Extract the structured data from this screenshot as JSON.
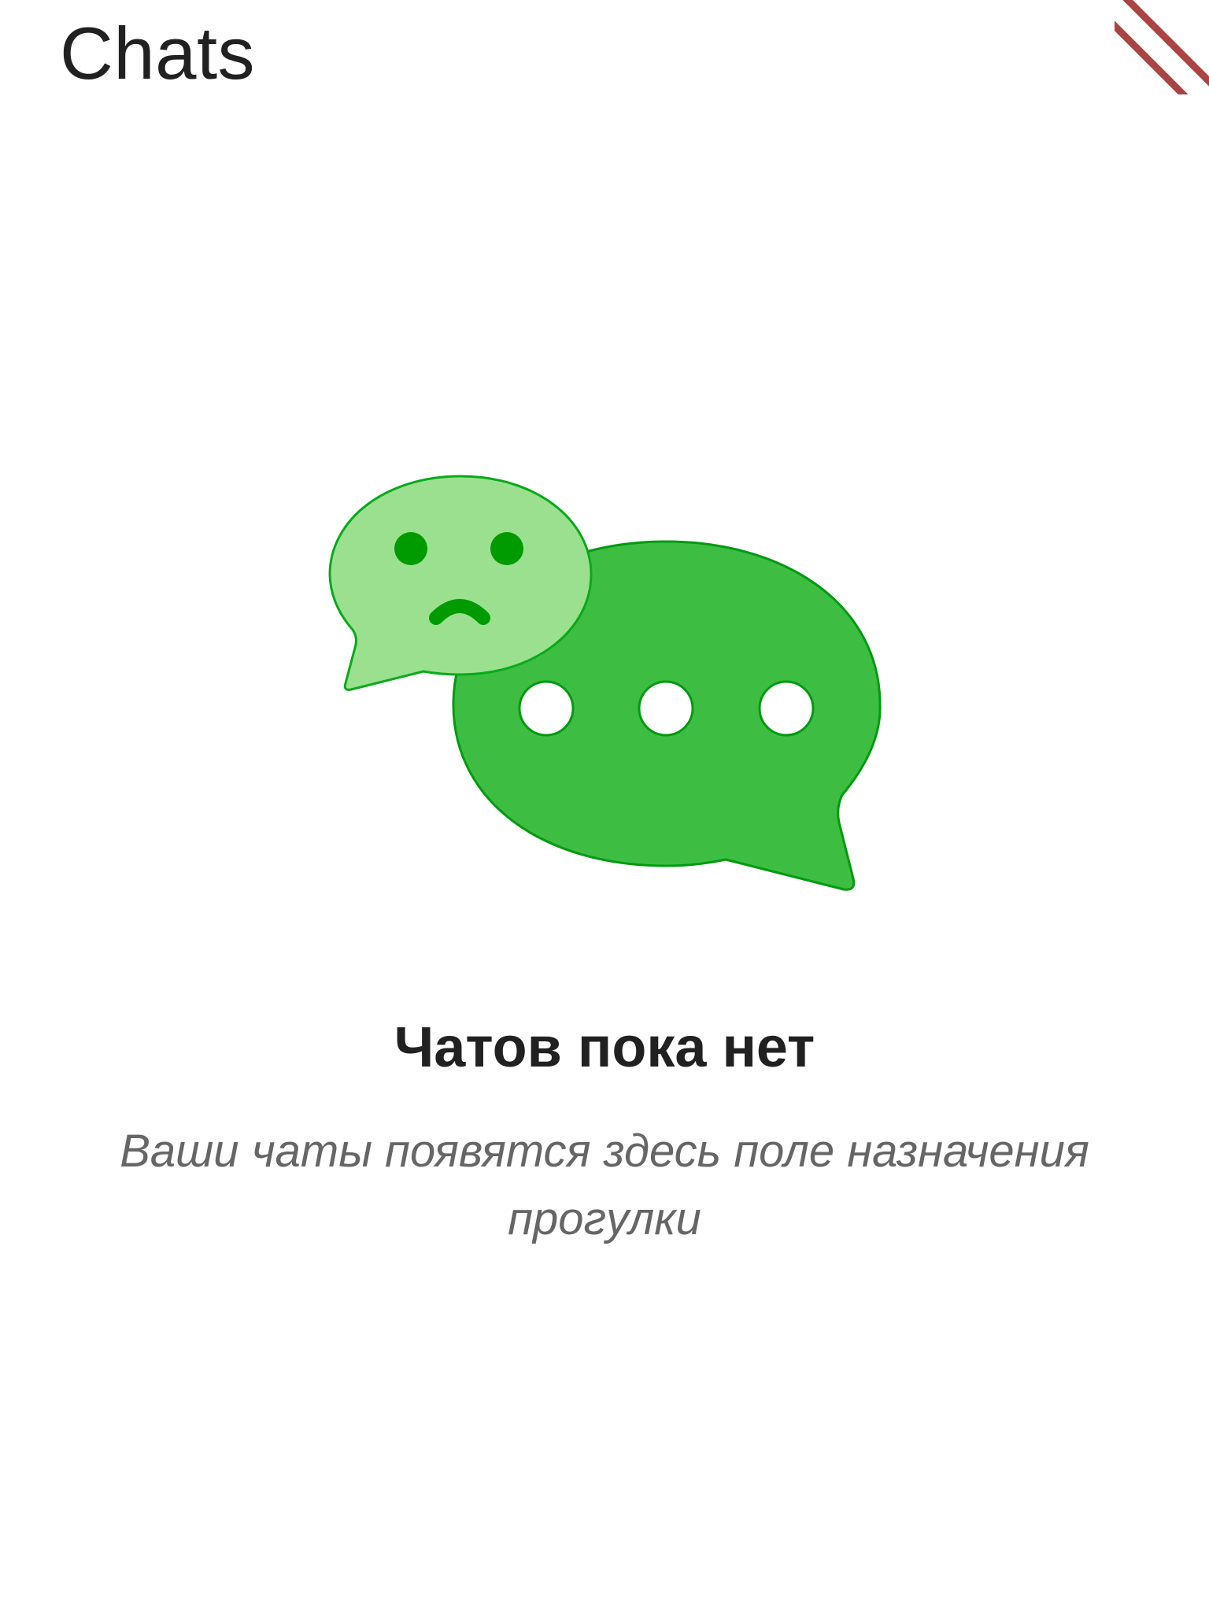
{
  "header": {
    "title": "Chats"
  },
  "empty_state": {
    "illustration_icon": "sad-chat-bubbles-icon",
    "title": "Чатов пока нет",
    "message": "Ваши чаты появятся здесь поле назначения прогулки"
  },
  "colors": {
    "bubble_dark": "#3dbe43",
    "bubble_light": "#9ae08f",
    "stroke": "#009b0f",
    "face": "#009b00",
    "title_text": "#212121",
    "message_text": "#666666",
    "debug_banner": "#a94442"
  }
}
